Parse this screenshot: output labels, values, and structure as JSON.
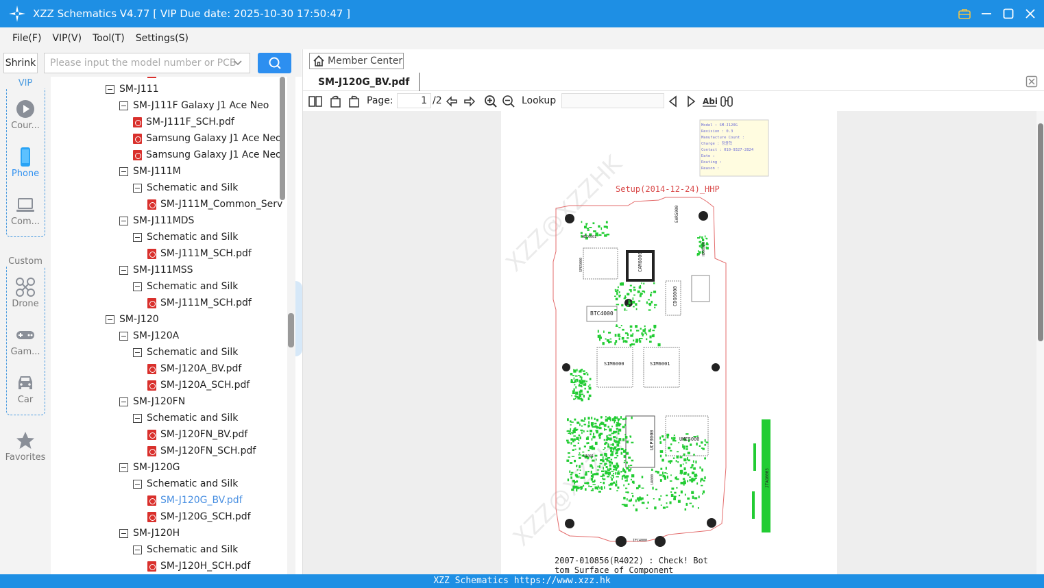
{
  "window": {
    "title": "XZZ Schematics V4.77 [ VIP Due date: 2025-10-30 17:50:47 ]"
  },
  "menu": [
    "File(F)",
    "VIP(V)",
    "Tool(T)",
    "Settings(S)"
  ],
  "search": {
    "shrink_label": "Shrink",
    "placeholder": "Please input the model number or PCB"
  },
  "leftnav": {
    "vip_title": "VIP",
    "custom_title": "Custom",
    "vip_items": [
      {
        "label": "Cour...",
        "icon": "play-circle-icon"
      },
      {
        "label": "Phone",
        "icon": "phone-icon",
        "active": true
      },
      {
        "label": "Com...",
        "icon": "laptop-icon"
      }
    ],
    "custom_items": [
      {
        "label": "Drone",
        "icon": "drone-icon"
      },
      {
        "label": "Gam...",
        "icon": "gamepad-icon"
      },
      {
        "label": "Car",
        "icon": "car-icon"
      }
    ],
    "favorites": {
      "label": "Favorites",
      "icon": "star-icon"
    }
  },
  "tree": [
    {
      "level": 0,
      "type": "folder",
      "label": "SM-J111"
    },
    {
      "level": 1,
      "type": "folder",
      "label": "SM-J111F Galaxy J1 Ace Neo"
    },
    {
      "level": 2,
      "type": "file",
      "label": "SM-J111F_SCH.pdf"
    },
    {
      "level": 2,
      "type": "file",
      "label": "Samsung Galaxy J1 Ace Neo"
    },
    {
      "level": 2,
      "type": "file",
      "label": "Samsung Galaxy J1 Ace Neo"
    },
    {
      "level": 1,
      "type": "folder",
      "label": "SM-J111M"
    },
    {
      "level": 2,
      "type": "folder",
      "label": "Schematic and Silk"
    },
    {
      "level": 3,
      "type": "file",
      "label": "SM-J111M_Common_Serv"
    },
    {
      "level": 1,
      "type": "folder",
      "label": "SM-J111MDS"
    },
    {
      "level": 2,
      "type": "folder",
      "label": "Schematic and Silk"
    },
    {
      "level": 3,
      "type": "file",
      "label": "SM-J111M_SCH.pdf"
    },
    {
      "level": 1,
      "type": "folder",
      "label": "SM-J111MSS"
    },
    {
      "level": 2,
      "type": "folder",
      "label": "Schematic and Silk"
    },
    {
      "level": 3,
      "type": "file",
      "label": "SM-J111M_SCH.pdf"
    },
    {
      "level": 0,
      "type": "folder",
      "label": "SM-J120"
    },
    {
      "level": 1,
      "type": "folder",
      "label": "SM-J120A"
    },
    {
      "level": 2,
      "type": "folder",
      "label": "Schematic and Silk"
    },
    {
      "level": 3,
      "type": "file",
      "label": "SM-J120A_BV.pdf"
    },
    {
      "level": 3,
      "type": "file",
      "label": "SM-J120A_SCH.pdf"
    },
    {
      "level": 1,
      "type": "folder",
      "label": "SM-J120FN"
    },
    {
      "level": 2,
      "type": "folder",
      "label": "Schematic and Silk"
    },
    {
      "level": 3,
      "type": "file",
      "label": "SM-J120FN_BV.pdf"
    },
    {
      "level": 3,
      "type": "file",
      "label": "SM-J120FN_SCH.pdf"
    },
    {
      "level": 1,
      "type": "folder",
      "label": "SM-J120G"
    },
    {
      "level": 2,
      "type": "folder",
      "label": "Schematic and Silk"
    },
    {
      "level": 3,
      "type": "file",
      "label": "SM-J120G_BV.pdf",
      "selected": true
    },
    {
      "level": 3,
      "type": "file",
      "label": "SM-J120G_SCH.pdf"
    },
    {
      "level": 1,
      "type": "folder",
      "label": "SM-J120H"
    },
    {
      "level": 2,
      "type": "folder",
      "label": "Schematic and Silk"
    },
    {
      "level": 3,
      "type": "file",
      "label": "SM-J120H_SCH.pdf"
    }
  ],
  "right": {
    "member_center": "Member Center",
    "active_tab": "SM-J120G_BV.pdf",
    "toolbar": {
      "page_label": "Page:",
      "page_current": "1",
      "page_total": "/2",
      "lookup_label": "Lookup",
      "lookup_value": ""
    }
  },
  "document": {
    "info_box": [
      "Model : SM-J120G",
      "Revision : 0.3",
      "Manufacture Count :",
      "Charge : 장윤혁",
      "Contact : 010-9327-2824",
      "Date :",
      "Routing :",
      "Reason :"
    ],
    "setup_text": "Setup(2014-12-24)_HHP",
    "watermark": "XZZ@XZZHK",
    "components": [
      "EAR5000",
      "HDC6001",
      "SPK5000",
      "CAM6000",
      "HDO6000",
      "BTC4000",
      "CDG6000",
      "SIM6000",
      "SIM6001",
      "UCP3000",
      "UME5000",
      "U1001",
      "JTAG6003",
      "IFC4000",
      "U4000"
    ],
    "note_line1": "2007-010856(R4022) : Check! Bot",
    "note_line2": "tom Surface of Component"
  },
  "footer": {
    "text": "XZZ Schematics https://www.xzz.hk"
  },
  "colors": {
    "accent": "#1e8fe4",
    "pdf_icon": "#d9302c",
    "selected_text": "#4a90e2"
  }
}
